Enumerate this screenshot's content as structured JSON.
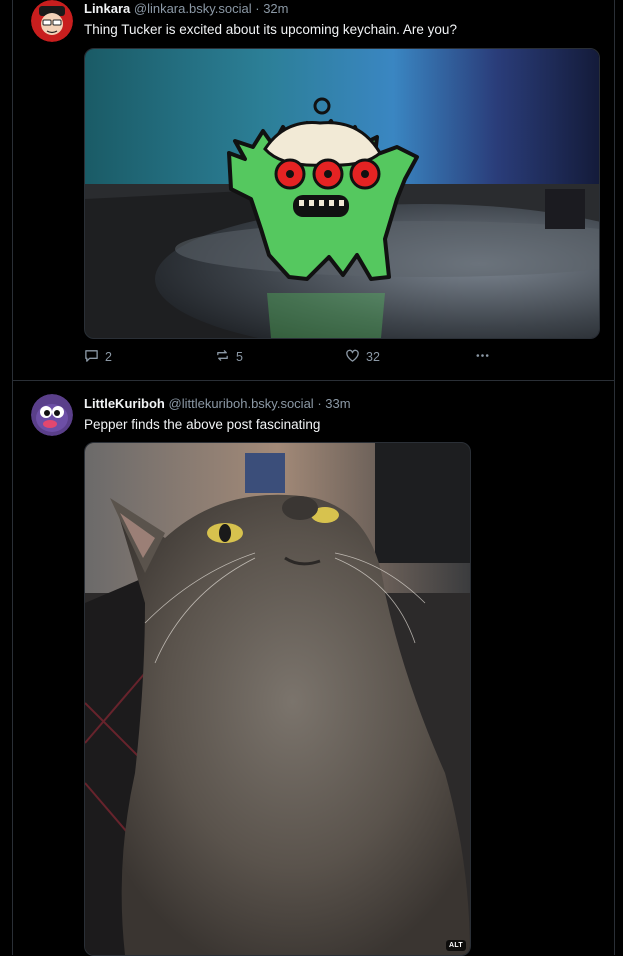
{
  "posts": [
    {
      "author": {
        "display_name": "Linkara",
        "handle": "@linkara.bsky.social",
        "time": "32m"
      },
      "text": "Thing Tucker is excited about its upcoming keychain. Are you?",
      "image": {
        "description": "green monster keychain with three red eyes on a dark round stand"
      },
      "actions": {
        "replies": "2",
        "reposts": "5",
        "likes": "32"
      }
    },
    {
      "author": {
        "display_name": "LittleKuriboh",
        "handle": "@littlekuriboh.bsky.social",
        "time": "33m"
      },
      "text": "Pepper finds the above post fascinating",
      "image": {
        "alt_badge": "ALT"
      }
    }
  ],
  "separator": "·",
  "icons": {
    "reply": "reply-icon",
    "repost": "repost-icon",
    "like": "heart-icon",
    "more": "more-icon"
  },
  "colors": {
    "background": "#000000",
    "border": "#2a2f36",
    "muted": "#8b98a5",
    "text": "#f1f3f5"
  }
}
